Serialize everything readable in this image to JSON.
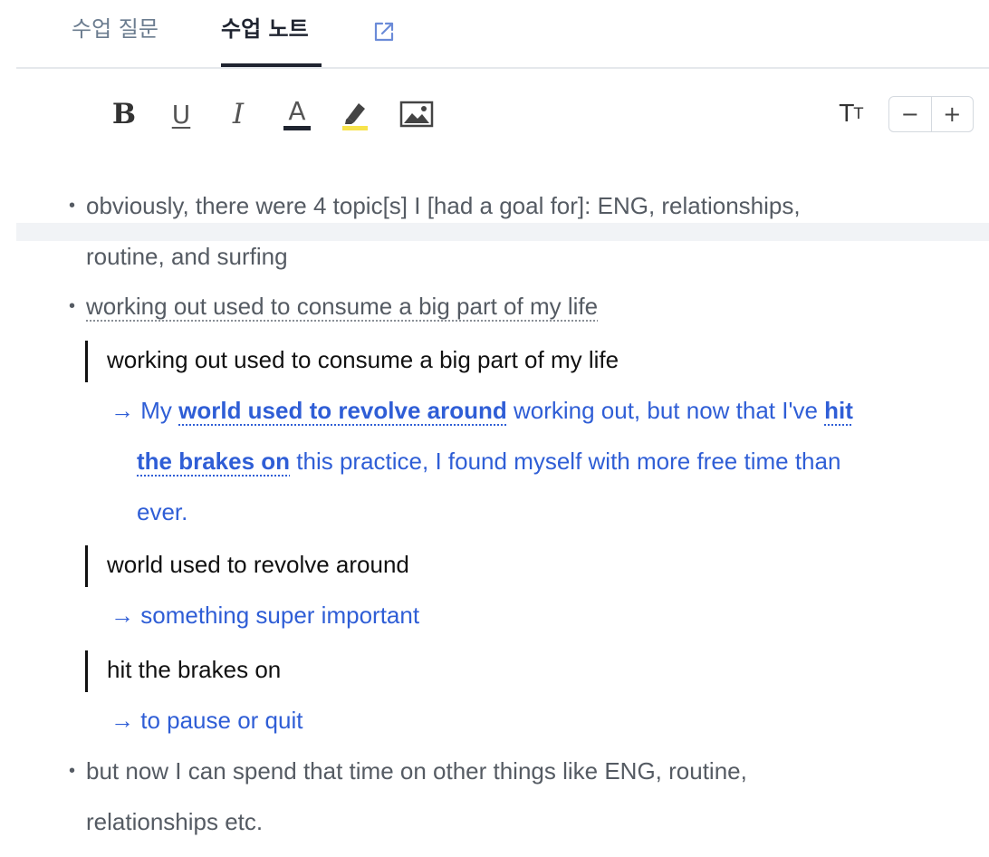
{
  "tabs": {
    "questions_label": "수업 질문",
    "notes_label": "수업 노트",
    "active": "notes"
  },
  "toolbar": {
    "bold": "B",
    "underline": "U",
    "italic": "I",
    "text_color": "A",
    "font_size_label_big": "T",
    "font_size_label_small": "T",
    "decrease": "−",
    "increase": "+"
  },
  "colors": {
    "accent_text": "#2f5ed6",
    "highlight": "#f7e34b",
    "tab_active": "#1f2430"
  },
  "notes": {
    "bullet": "•",
    "arrow": "→",
    "item1_line1": "obviously, there were 4 topic[s] I [had a goal for]: ENG, relationships,",
    "item1_line2": "routine, and surfing",
    "item2": "working out used to consume a big part of my life",
    "quote1": "working out used to consume a big part of my life",
    "correction1": {
      "p1": "My ",
      "b1": "world used to revolve around",
      "p2": " working out, but now that I've ",
      "b2a": "hit",
      "b2b": "the brakes on",
      "p3": " this practice, I found myself with more free time than",
      "p4": "ever."
    },
    "quote2": "world used to revolve around",
    "meaning2": "something super important",
    "quote3": "hit the brakes on",
    "meaning3": "to pause or quit",
    "item3_line1": "but now I can spend that time on other things like ENG, routine,",
    "item3_line2": "relationships etc."
  }
}
